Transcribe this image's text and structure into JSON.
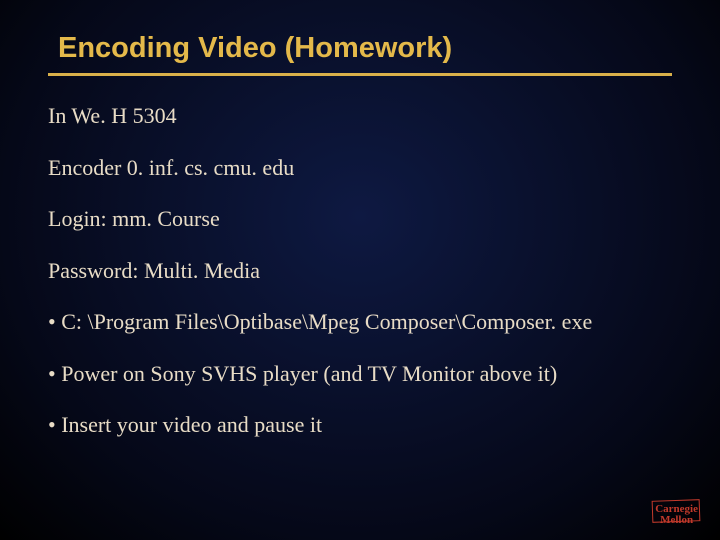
{
  "title": "Encoding Video (Homework)",
  "lines": {
    "l1": "In We. H 5304",
    "l2": "Encoder 0. inf. cs. cmu. edu",
    "l3": "Login: mm. Course",
    "l4": "Password: Multi. Media",
    "b1": "• C: \\Program Files\\Optibase\\Mpeg Composer\\Composer. exe",
    "b2": "• Power on Sony SVHS player (and TV Monitor above it)",
    "b3": "• Insert your video and pause it"
  },
  "logo": {
    "line1": "Carnegie",
    "line2": "Mellon"
  }
}
